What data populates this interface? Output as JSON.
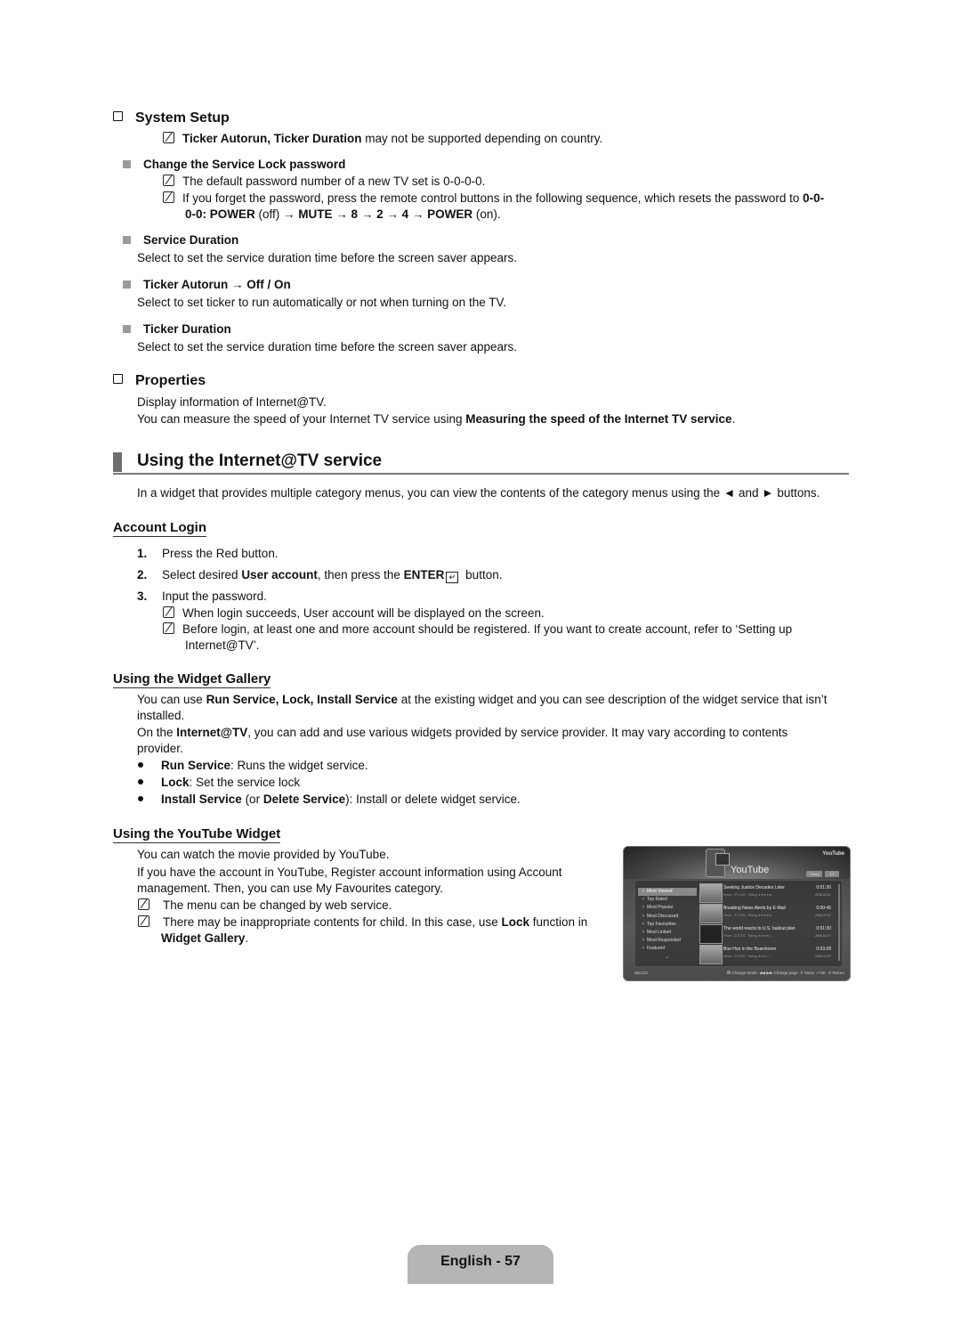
{
  "system_setup": {
    "heading": "System Setup",
    "note": {
      "bold": "Ticker Autorun, Ticker Duration",
      "text": " may not be supported depending on country."
    },
    "items": [
      {
        "title": "Change the Service Lock password",
        "notes": [
          "The default password number of a new TV set is 0-0-0-0.",
          "If you forget the password, press the remote control buttons in the following sequence, which resets the password to "
        ],
        "reset_seq_bold_1": "0-0-",
        "reset_seq_line2": {
          "p1": "0-0: POWER",
          "p2": " (off) → ",
          "p3": "MUTE",
          "p4": " → ",
          "p5": "8",
          "p6": " → ",
          "p7": "2",
          "p8": " → ",
          "p9": "4",
          "p10": " → ",
          "p11": "POWER",
          "p12": " (on)."
        }
      },
      {
        "title": "Service Duration",
        "desc": "Select to set the service duration time before the screen saver appears."
      },
      {
        "title": "Ticker Autorun → Off / On",
        "desc": "Select to set ticker to run automatically or not when turning on the TV."
      },
      {
        "title": "Ticker Duration",
        "desc": "Select to set the service duration time before the screen saver appears."
      }
    ]
  },
  "properties": {
    "heading": "Properties",
    "line1": "Display information of Internet@TV.",
    "line2_pre": "You can measure the speed of your Internet TV service using ",
    "line2_bold": "Measuring the speed of the Internet TV service",
    "line2_post": "."
  },
  "internet_tv": {
    "heading": "Using the Internet@TV service",
    "intro": "In a widget that provides multiple category menus, you can view the contents of the category menus using the ◄ and ► buttons."
  },
  "account_login": {
    "heading": "Account Login",
    "steps": [
      {
        "num": "1.",
        "text": "Press the Red button."
      },
      {
        "num": "2.",
        "pre": "Select desired ",
        "bold1": "User account",
        "mid": ", then press the ",
        "bold2": "ENTER",
        "post": " button."
      },
      {
        "num": "3.",
        "text": "Input the password."
      }
    ],
    "notes": [
      "When login succeeds, User account will be displayed on the screen.",
      "Before login, at least one and more account should be registered. If you want to create account, refer to ‘Setting up",
      "Internet@TV’."
    ]
  },
  "widget_gallery": {
    "heading": "Using the Widget Gallery",
    "p1_pre": "You can use ",
    "p1_bold": "Run Service, Lock, Install Service",
    "p1_post": " at the existing widget and you can see description of the widget service that isn’t",
    "p1_line2": "installed.",
    "p2_pre": "On the ",
    "p2_bold": "Internet@TV",
    "p2_post": ", you can add and use various widgets provided by service provider. It may vary according to contents",
    "p2_line2": "provider.",
    "bullets": [
      {
        "bold": "Run Service",
        "text": ": Runs the widget service."
      },
      {
        "bold": "Lock",
        "text": ": Set the service lock"
      },
      {
        "bold": "Install Service",
        "mid": " (or ",
        "bold2": "Delete Service",
        "text": "): Install or delete widget service."
      }
    ]
  },
  "youtube_widget": {
    "heading": "Using the YouTube Widget",
    "line1": "You can watch the movie provided by YouTube.",
    "line2": "If you have the account in YouTube, Register account information using Account",
    "line3": "management. Then, you can use My Favourites category.",
    "notes": [
      {
        "text": "The menu can be changed by web service."
      },
      {
        "pre": "There may be inappropriate contents for child. In this case, use ",
        "bold": "Lock",
        "post": " function in",
        "line2_bold": "Widget Gallery",
        "line2_post": "."
      }
    ]
  },
  "yt_screen": {
    "title": "YouTube",
    "logo": "YouTube",
    "tabs": [
      "Today",
      "1/7"
    ],
    "menu": [
      "Most Viewed",
      "Top Rated",
      "Most Popular",
      "Most Discussed",
      "Top Favourites",
      "Most Linked",
      "Most Responded",
      "Featured"
    ],
    "selected_menu": "Most Viewed",
    "videos": [
      {
        "title": "Seeking Justice Decades Later",
        "views": "Views : 373,252",
        "rating": "Rating ★★★★★",
        "duration": "0:01:30",
        "date": "2008-02-07"
      },
      {
        "title": "Breaking News Alerts by E-Mail",
        "views": "Views : 373,252",
        "rating": "Rating ★★★★★",
        "duration": "0:00:45",
        "date": "2008-02-07"
      },
      {
        "title": "The world reacts to U.S. bailout plan",
        "views": "Views : 373,252",
        "rating": "Rating ★★★★☆",
        "duration": "0:01:30",
        "date": "2008-02-07"
      },
      {
        "title": "Boo Hoo in the Boardroom",
        "views": "Views : 373,252",
        "rating": "Rating ★★★☆☆",
        "duration": "0:03:28",
        "date": "2008-02-07"
      }
    ],
    "page_indicator": "abc123",
    "hints": {
      "mode": "Change Mode",
      "page": "◀◀ ▶▶ Change page",
      "move": "⇕ Move",
      "ok": "OK",
      "ret": "↺ Return"
    }
  },
  "footer": {
    "page_label": "English - 57"
  }
}
